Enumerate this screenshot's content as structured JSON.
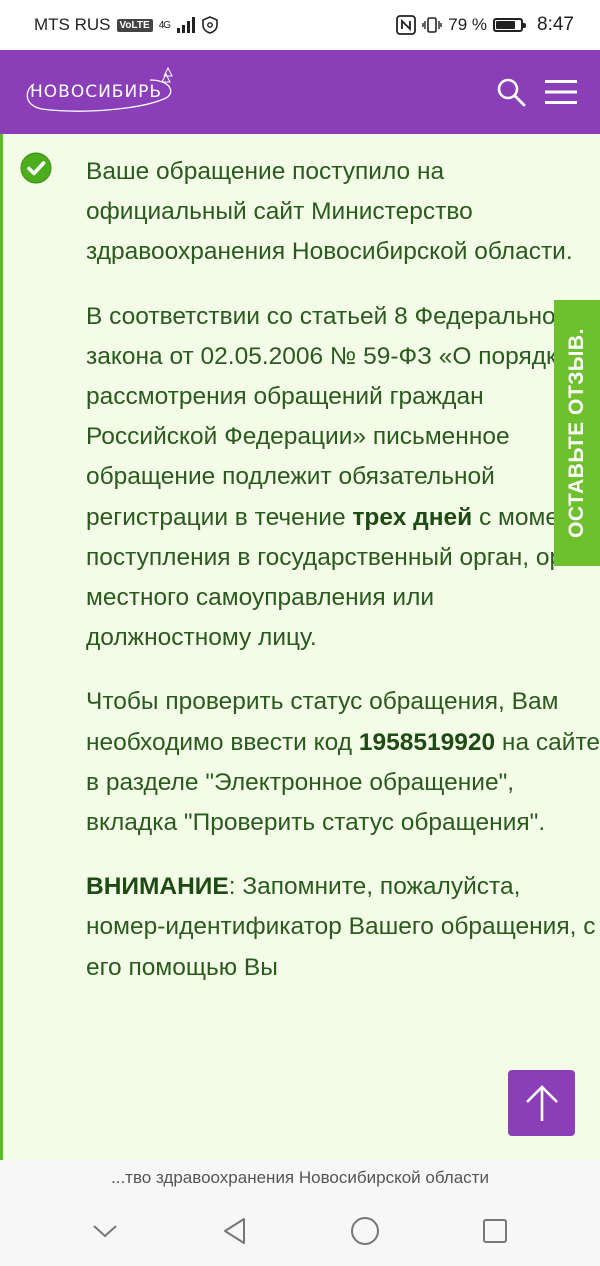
{
  "status_bar": {
    "carrier": "MTS RUS",
    "volte": "VoLTE",
    "network": "4G",
    "battery_percent": "79 %",
    "battery_level": 0.79,
    "time": "8:47"
  },
  "header": {
    "logo_text": "НОВОСИБИРЬ"
  },
  "message": {
    "p1": "Ваше обращение поступило на официальный сайт Министерство здравоохранения Новосибирской области.",
    "p2_before": "В соответствии со статьей 8 Федерального закона от 02.05.2006 № 59-ФЗ «О порядке рассмотрения обращений граждан Российской Федерации» письменное обращение подлежит обязательной регистрации в течение ",
    "p2_bold": "трех дней",
    "p2_after": " с момента поступления в государственный орган, орган местного самоуправления или должностному лицу.",
    "p3_before": "Чтобы проверить статус обращения, Вам необходимо ввести код ",
    "p3_code": "1958519920",
    "p3_after": " на сайте в разделе \"Электронное обращение\", вкладка \"Проверить статус обращения\".",
    "p4_bold": "ВНИМАНИЕ",
    "p4_after": ": Запомните, пожалуйста, номер-идентификатор Вашего обращения, с его помощью Вы"
  },
  "feedback_tab": {
    "label": "ОСТАВЬТЕ ОТЗЫВ."
  },
  "browser": {
    "url_title": "...тво здравоохранения Новосибирской области"
  },
  "colors": {
    "brand_purple": "#8a3fb8",
    "success_bg": "#f3fce7",
    "success_green": "#5bbb1e",
    "text_green": "#2a5a1e"
  }
}
